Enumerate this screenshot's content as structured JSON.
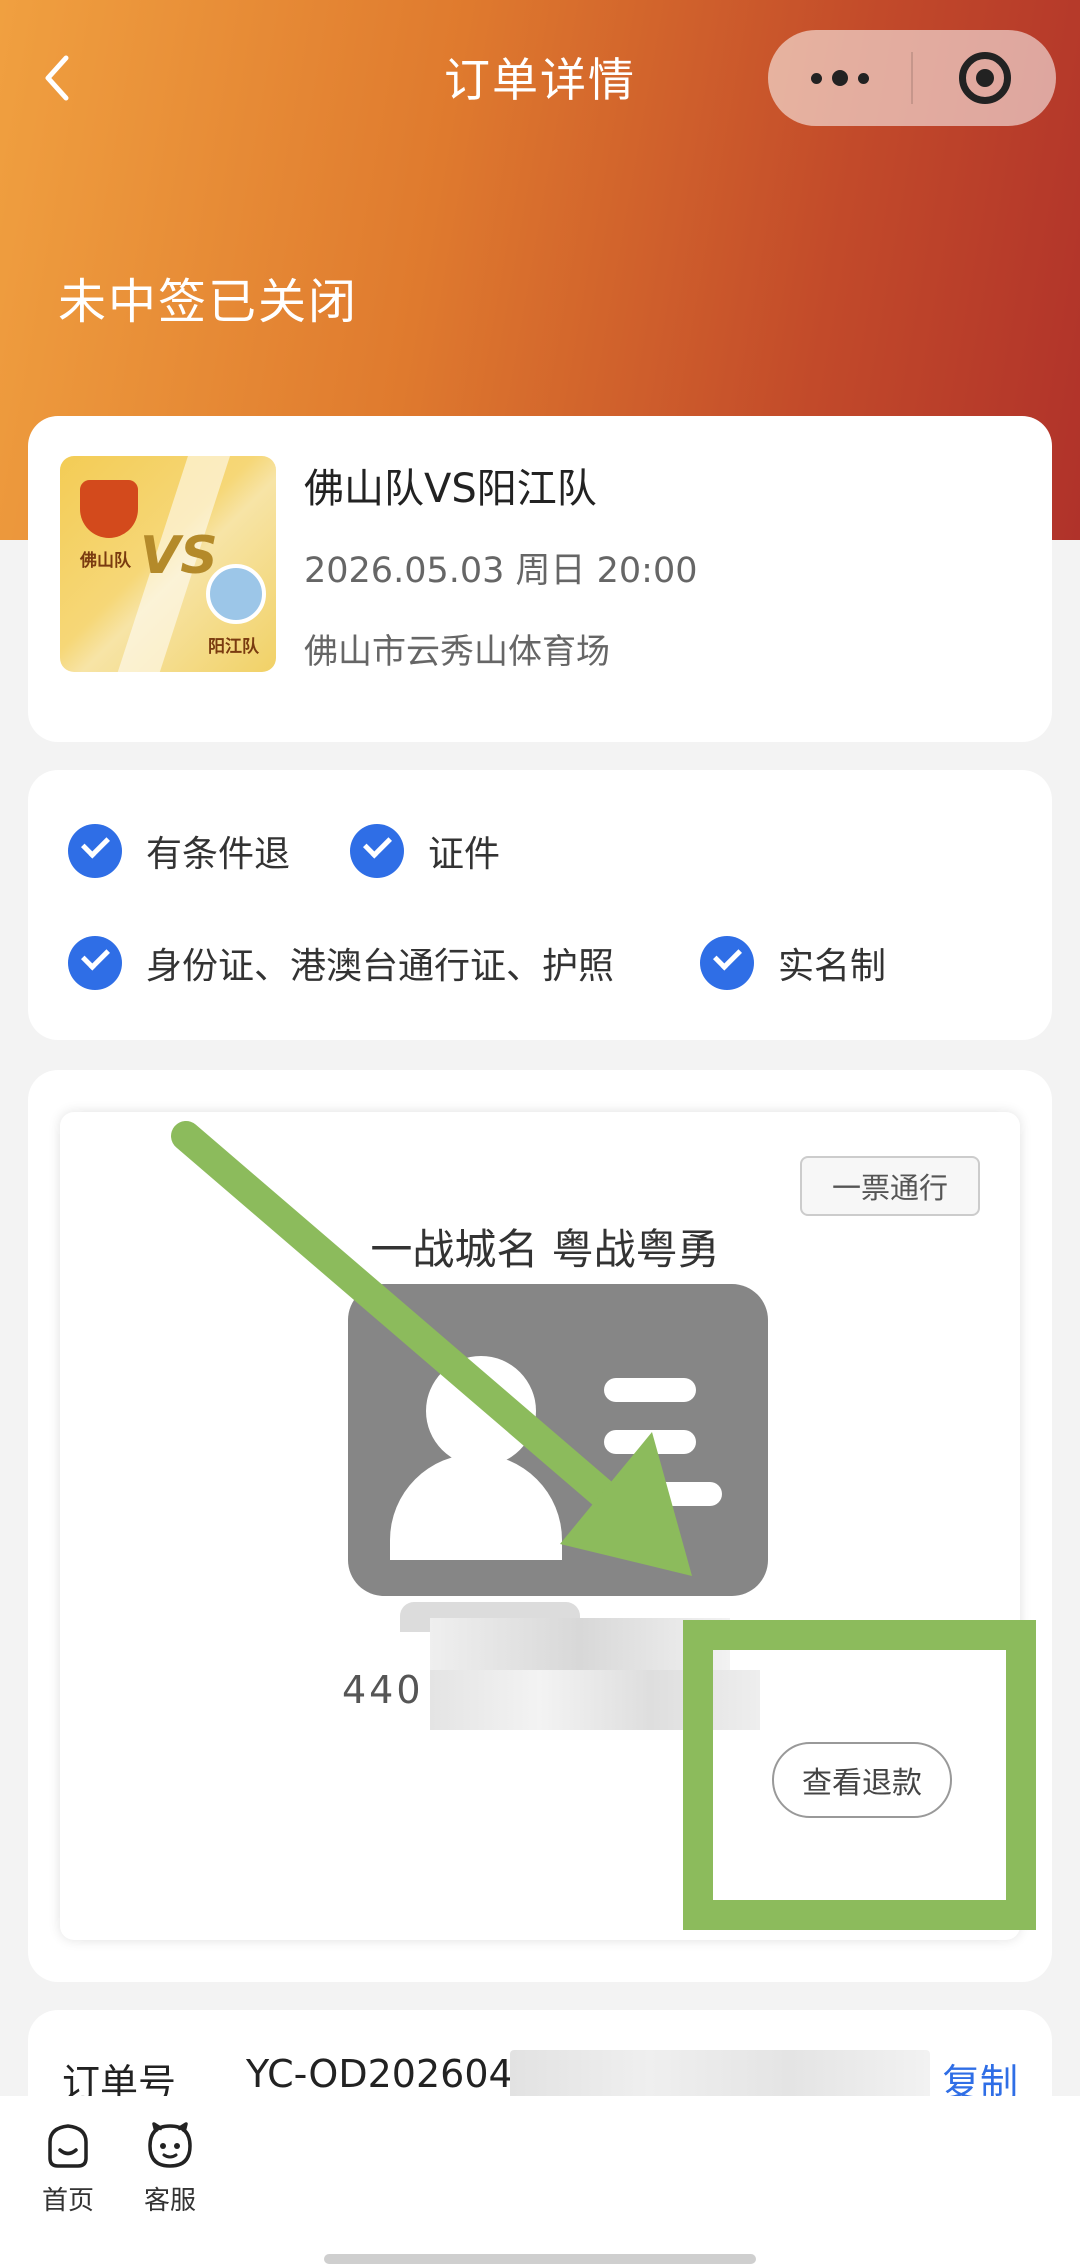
{
  "nav": {
    "title": "订单详情"
  },
  "status": {
    "title": "未中签已关闭"
  },
  "event": {
    "name": "佛山队VS阳江队",
    "datetime": "2026.05.03 周日 20:00",
    "venue": "佛山市云秀山体育场",
    "poster": {
      "team_a": "佛山队",
      "team_b": "阳江队",
      "vs": "VS"
    }
  },
  "rules": [
    {
      "label": "有条件退"
    },
    {
      "label": "证件"
    },
    {
      "label": "身份证、港澳台通行证、护照"
    },
    {
      "label": "实名制"
    }
  ],
  "ticket": {
    "badge": "一票通行",
    "title": "一战城名 粤战粤勇",
    "id_number_visible": "440",
    "refund_button": "查看退款"
  },
  "order": {
    "label": "订单号",
    "value_visible": "YC-OD202604",
    "copy_label": "复制"
  },
  "tabbar": {
    "items": [
      {
        "label": "首页",
        "icon": "home-icon"
      },
      {
        "label": "客服",
        "icon": "customer-service-icon"
      }
    ]
  },
  "colors": {
    "header_start": "#f0a040",
    "header_end": "#b0322a",
    "check_blue": "#2f6ee6",
    "annotation_green": "#8cbb5c",
    "link_blue": "#2f6ee6"
  }
}
